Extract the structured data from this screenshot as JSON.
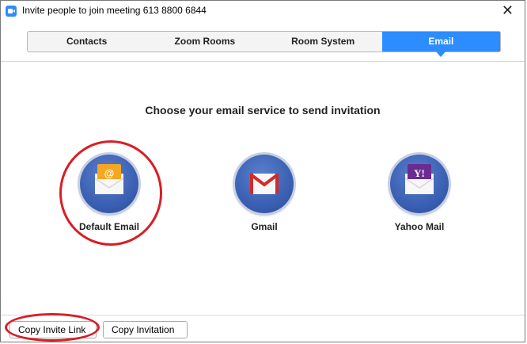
{
  "window": {
    "title": "Invite people to join meeting 613 8800 6844"
  },
  "tabs": [
    {
      "label": "Contacts",
      "active": false
    },
    {
      "label": "Zoom Rooms",
      "active": false
    },
    {
      "label": "Room System",
      "active": false
    },
    {
      "label": "Email",
      "active": true
    }
  ],
  "main": {
    "heading": "Choose your email service to send invitation",
    "services": [
      {
        "label": "Default Email",
        "icon": "default-email-icon",
        "highlighted": true
      },
      {
        "label": "Gmail",
        "icon": "gmail-icon",
        "highlighted": false
      },
      {
        "label": "Yahoo Mail",
        "icon": "yahoo-mail-icon",
        "highlighted": false
      }
    ]
  },
  "footer": {
    "copy_link_label": "Copy Invite Link",
    "copy_invitation_label": "Copy Invitation"
  },
  "colors": {
    "accent": "#2d8cff",
    "highlight": "#d81f26"
  }
}
